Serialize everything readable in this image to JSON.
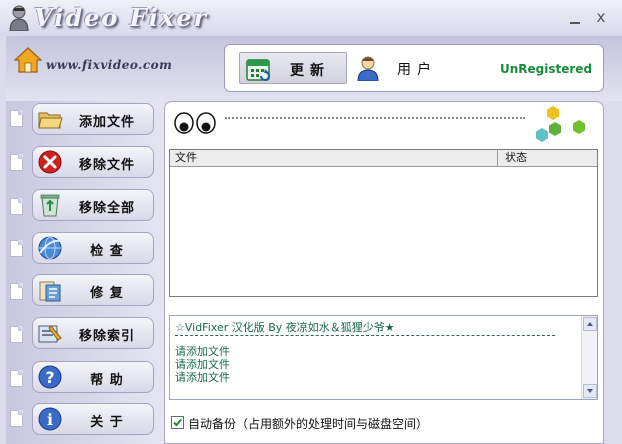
{
  "window": {
    "title": "Video Fixer",
    "minimize_label": "_",
    "close_label": "x",
    "logo_text": "www.fixvideo.com"
  },
  "toolbar": {
    "update_label": "更新",
    "user_label": "用户",
    "registration_status": "UnRegistered"
  },
  "sidebar": {
    "items": [
      {
        "label": "添加文件",
        "icon": "folder-icon"
      },
      {
        "label": "移除文件",
        "icon": "remove-icon"
      },
      {
        "label": "移除全部",
        "icon": "recycle-bin-icon"
      },
      {
        "label": "检 查",
        "icon": "check-globe-icon"
      },
      {
        "label": "修 复",
        "icon": "repair-icon"
      },
      {
        "label": "移除索引",
        "icon": "remove-index-icon"
      },
      {
        "label": "帮 助",
        "icon": "help-icon"
      },
      {
        "label": "关 于",
        "icon": "about-icon"
      }
    ]
  },
  "file_table": {
    "columns": [
      "文件",
      "状态"
    ],
    "rows": []
  },
  "log": {
    "title": "☆VidFixer 汉化版 By 夜凉如水＆狐狸少爷★",
    "lines": [
      "请添加文件",
      "请添加文件",
      "请添加文件"
    ]
  },
  "backup": {
    "checked": true,
    "label": "自动备份（占用额外的处理时间与磁盘空间）"
  },
  "colors": {
    "registration": "#1a8a3a",
    "log_text": "#1a6a50"
  }
}
